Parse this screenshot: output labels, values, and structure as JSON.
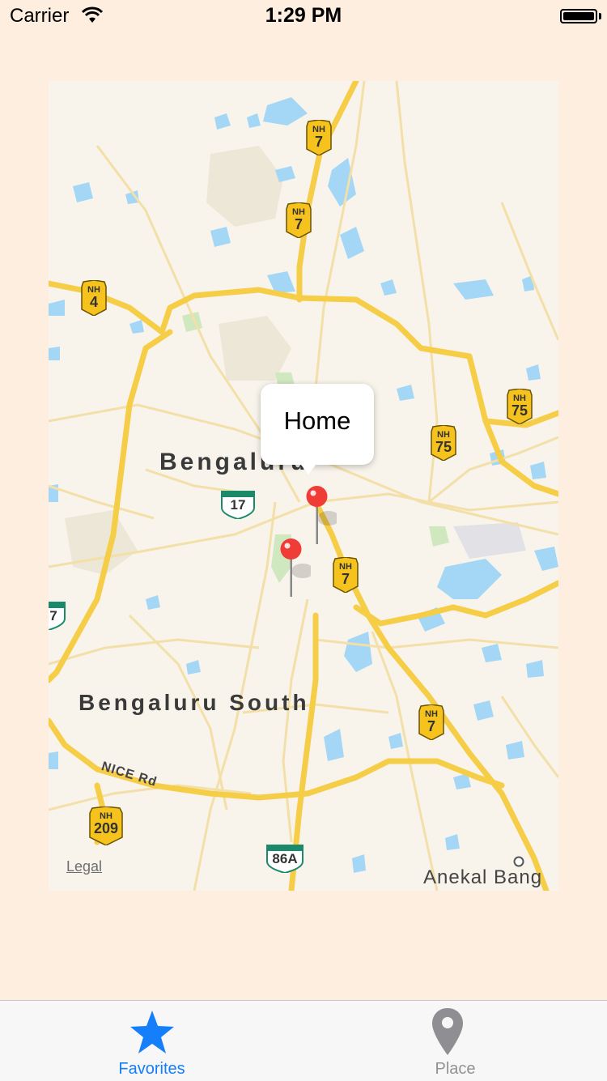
{
  "status_bar": {
    "carrier": "Carrier",
    "time": "1:29 PM"
  },
  "map": {
    "labels": {
      "bengaluru": "Bengaluru",
      "bengaluru_south": "Bengaluru South",
      "anekal": "Anekal Bang",
      "road_nice": "NICE Rd",
      "legal": "Legal"
    },
    "nh_shields": [
      {
        "prefix": "NH",
        "number": "7"
      },
      {
        "prefix": "NH",
        "number": "7"
      },
      {
        "prefix": "NH",
        "number": "4"
      },
      {
        "prefix": "NH",
        "number": "75"
      },
      {
        "prefix": "NH",
        "number": "75"
      },
      {
        "prefix": "NH",
        "number": "7"
      },
      {
        "prefix": "NH",
        "number": "7"
      },
      {
        "prefix": "NH",
        "number": "209"
      }
    ],
    "green_shields": [
      "17",
      "86A",
      "7"
    ],
    "callout": {
      "title": "Home"
    }
  },
  "tab_bar": {
    "favorites_label": "Favorites",
    "place_label": "Place",
    "active_color": "#147EFB",
    "inactive_color": "#929292"
  },
  "colors": {
    "background": "#FEEEE0",
    "map_land": "#F8F4EC",
    "water": "#A3D7F5",
    "highway": "#F6CD47",
    "pin": "#F03C36"
  }
}
